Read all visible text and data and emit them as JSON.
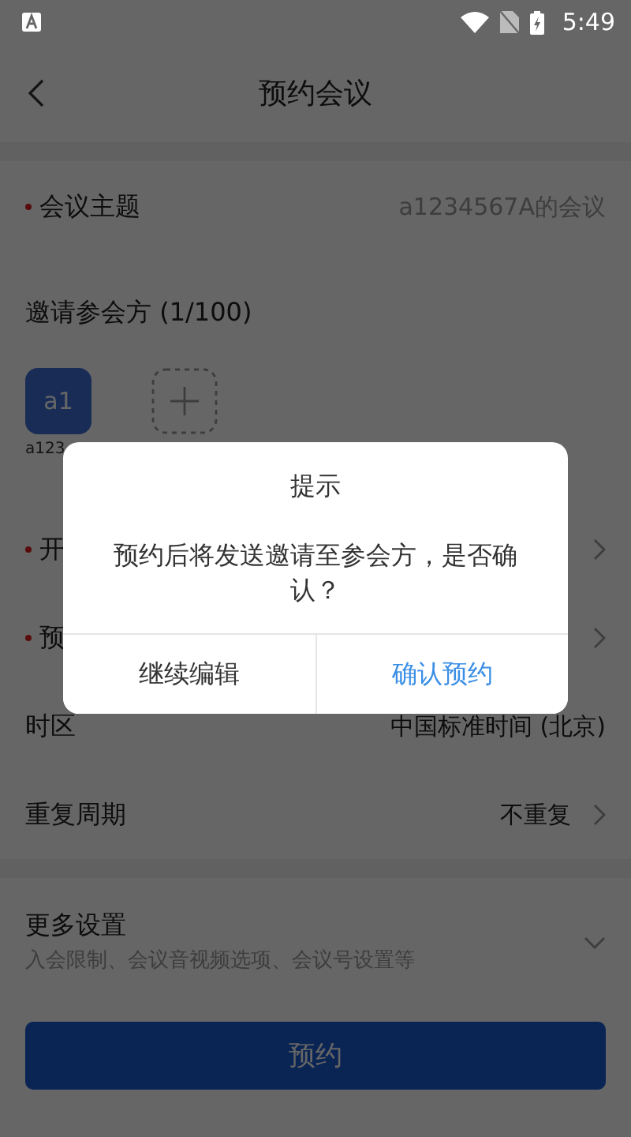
{
  "status_bar": {
    "time": "5:49"
  },
  "header": {
    "title": "预约会议"
  },
  "topic": {
    "label": "会议主题",
    "required": true,
    "value": "a1234567A的会议"
  },
  "invite": {
    "title": "邀请参会方 (1/100)",
    "participants": [
      {
        "avatar": "a1",
        "name": "a123"
      }
    ]
  },
  "settings": [
    {
      "label": "开",
      "required": true,
      "chevron": true
    },
    {
      "label": "预",
      "required": true,
      "chevron": true
    },
    {
      "label": "时区",
      "required": false,
      "value": "中国标准时间 (北京)",
      "chevron": false
    },
    {
      "label": "重复周期",
      "required": false,
      "value": "不重复",
      "chevron": true
    }
  ],
  "more": {
    "title": "更多设置",
    "subtitle": "入会限制、会议音视频选项、会议号设置等",
    "expanded": false
  },
  "submit_button": "预约",
  "dialog": {
    "title": "提示",
    "message": "预约后将发送邀请至参会方，是否确认？",
    "buttons": [
      {
        "label": "继续编辑",
        "primary": false
      },
      {
        "label": "确认预约",
        "primary": true
      }
    ]
  }
}
